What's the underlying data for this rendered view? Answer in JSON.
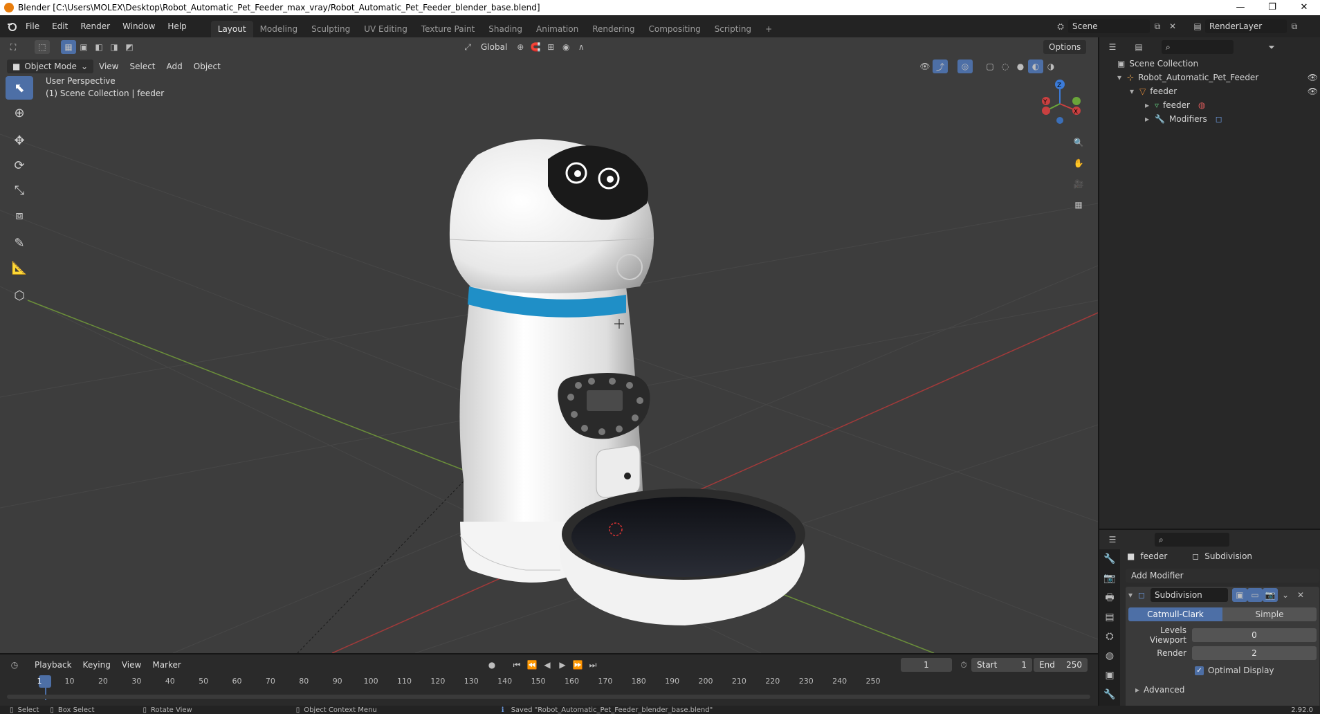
{
  "window": {
    "title": "Blender [C:\\Users\\MOLEX\\Desktop\\Robot_Automatic_Pet_Feeder_max_vray/Robot_Automatic_Pet_Feeder_blender_base.blend]",
    "minimize": "—",
    "restore": "❐",
    "close": "✕"
  },
  "menus": [
    "File",
    "Edit",
    "Render",
    "Window",
    "Help"
  ],
  "workspaces": [
    "Layout",
    "Modeling",
    "Sculpting",
    "UV Editing",
    "Texture Paint",
    "Shading",
    "Animation",
    "Rendering",
    "Compositing",
    "Scripting"
  ],
  "workspace_add": "+",
  "scene": {
    "label": "Scene",
    "render_layer": "RenderLayer"
  },
  "header_tools": {
    "transform_orientation": "Global",
    "options": "Options"
  },
  "viewport": {
    "mode": "Object Mode",
    "menus": [
      "View",
      "Select",
      "Add",
      "Object"
    ],
    "info_line1": "User Perspective",
    "info_line2": "(1) Scene Collection | feeder",
    "gizmo": {
      "x": "X",
      "y": "Y",
      "z": "Z"
    }
  },
  "outliner": {
    "root": "Scene Collection",
    "items": [
      {
        "label": "Robot_Automatic_Pet_Feeder",
        "depth": 1
      },
      {
        "label": "feeder",
        "depth": 2
      },
      {
        "label": "feeder",
        "depth": 3
      },
      {
        "label": "Modifiers",
        "depth": 3
      }
    ]
  },
  "properties": {
    "object": "feeder",
    "modifier_tab": "Subdivision",
    "add_modifier": "Add Modifier",
    "modifier_name": "Subdivision",
    "algo_catmull": "Catmull-Clark",
    "algo_simple": "Simple",
    "levels_viewport_label": "Levels Viewport",
    "levels_viewport_value": "0",
    "render_label": "Render",
    "render_value": "2",
    "optimal_display": "Optimal Display",
    "advanced": "Advanced"
  },
  "timeline": {
    "menus": [
      "Playback",
      "Keying",
      "View",
      "Marker"
    ],
    "current_frame": "1",
    "start_label": "Start",
    "start_value": "1",
    "end_label": "End",
    "end_value": "250",
    "ticks": [
      "1",
      "10",
      "20",
      "30",
      "40",
      "50",
      "60",
      "70",
      "80",
      "90",
      "100",
      "110",
      "120",
      "130",
      "140",
      "150",
      "160",
      "170",
      "180",
      "190",
      "200",
      "210",
      "220",
      "230",
      "240",
      "250"
    ]
  },
  "statusbar": {
    "select": "Select",
    "box_select": "Box Select",
    "rotate_view": "Rotate View",
    "context_menu": "Object Context Menu",
    "message": "Saved \"Robot_Automatic_Pet_Feeder_blender_base.blend\"",
    "version": "2.92.0"
  }
}
